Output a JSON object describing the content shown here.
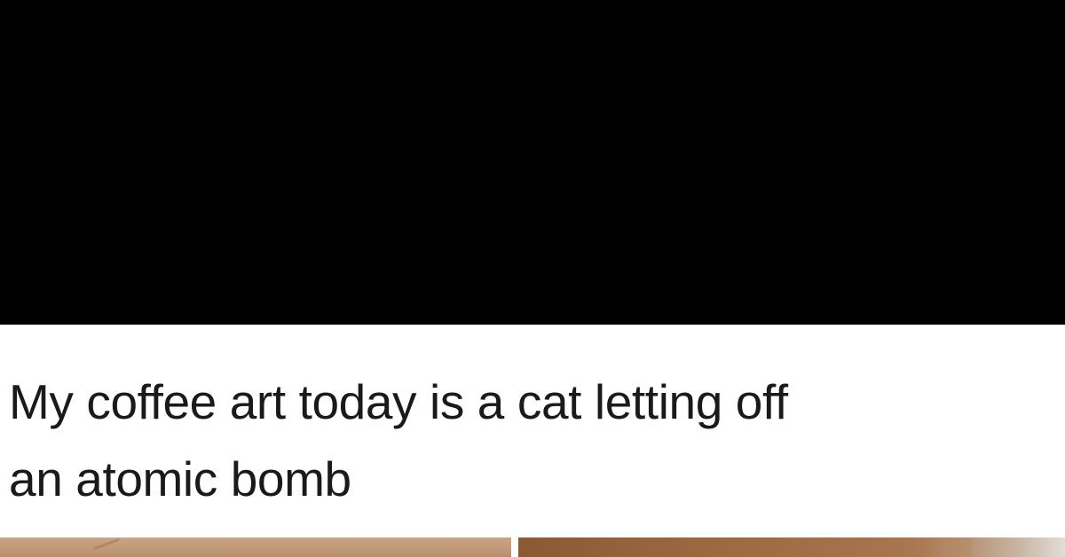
{
  "post": {
    "caption_line_1": "My coffee art today is a cat letting off",
    "caption_line_2": "an atomic bomb"
  },
  "colors": {
    "top_band": "#000000",
    "background": "#ffffff",
    "caption_text": "#1a1a1a"
  },
  "images": [
    {
      "name": "coffee-photo-left",
      "description_icon": "coffee-cup-photo"
    },
    {
      "name": "coffee-photo-right",
      "description_icon": "coffee-cup-photo"
    }
  ]
}
